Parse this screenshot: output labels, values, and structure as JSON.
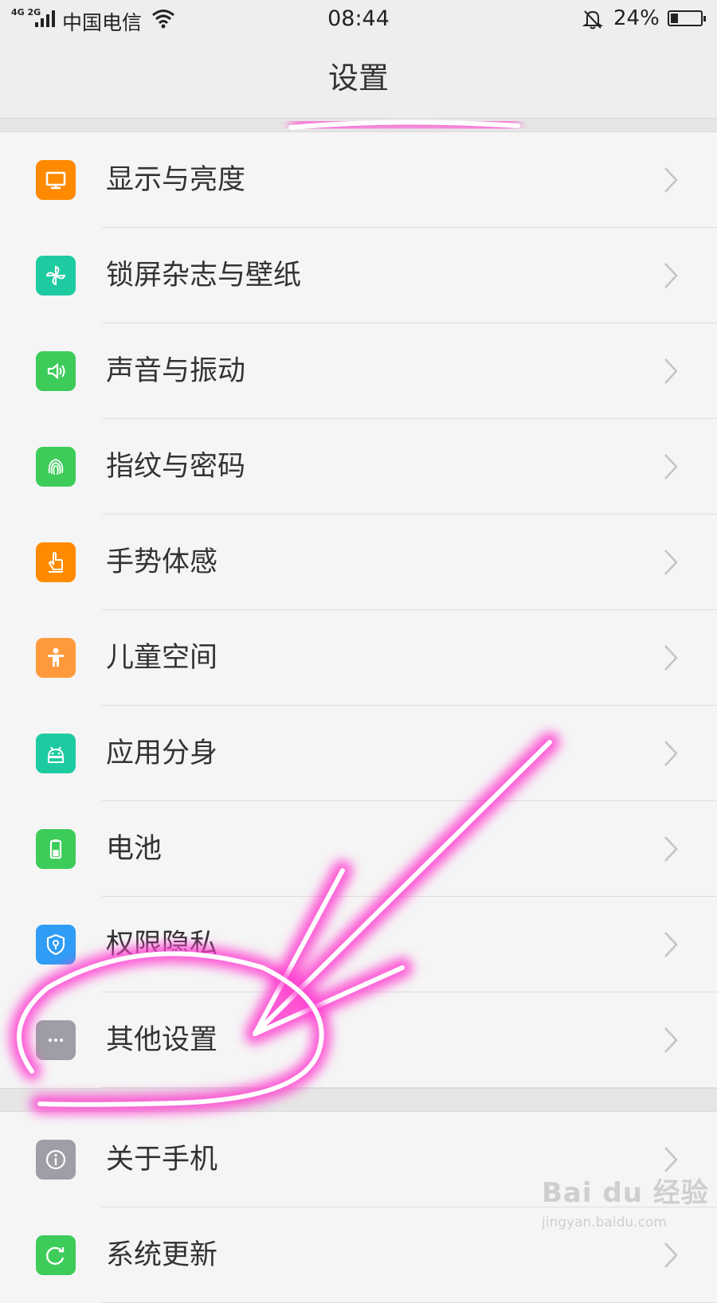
{
  "status_bar": {
    "network": "4G 2G",
    "carrier": "中国电信",
    "time": "08:44",
    "battery_percent_text": "24%",
    "battery_level": 0.24,
    "icons": [
      "signal-icon",
      "wifi-icon",
      "bell-mute-icon",
      "battery-icon"
    ]
  },
  "header": {
    "title": "设置"
  },
  "settings": {
    "group1": [
      {
        "label": "显示与亮度",
        "icon": "display-icon",
        "color": "#FF8A00"
      },
      {
        "label": "锁屏杂志与壁纸",
        "icon": "pinwheel-icon",
        "color": "#1ECBA0"
      },
      {
        "label": "声音与振动",
        "icon": "speaker-icon",
        "color": "#3DCC5A"
      },
      {
        "label": "指纹与密码",
        "icon": "fingerprint-icon",
        "color": "#3DCC5A"
      },
      {
        "label": "手势体感",
        "icon": "hand-pointer-icon",
        "color": "#FF8A00"
      },
      {
        "label": "儿童空间",
        "icon": "child-icon",
        "color": "#FF9A3C"
      },
      {
        "label": "应用分身",
        "icon": "android-clone-icon",
        "color": "#1ECBA0"
      },
      {
        "label": "电池",
        "icon": "battery-icon",
        "color": "#3DCC5A"
      },
      {
        "label": "权限隐私",
        "icon": "shield-icon",
        "color": "#2F9CF5"
      },
      {
        "label": "其他设置",
        "icon": "more-dots-icon",
        "color": "#9E9EA6"
      }
    ],
    "group2": [
      {
        "label": "关于手机",
        "icon": "info-icon",
        "color": "#9E9EA6"
      },
      {
        "label": "系统更新",
        "icon": "update-icon",
        "color": "#3DCC5A"
      }
    ]
  },
  "watermark": {
    "main": "Bai du 经验",
    "sub": "jingyan.baidu.com"
  }
}
